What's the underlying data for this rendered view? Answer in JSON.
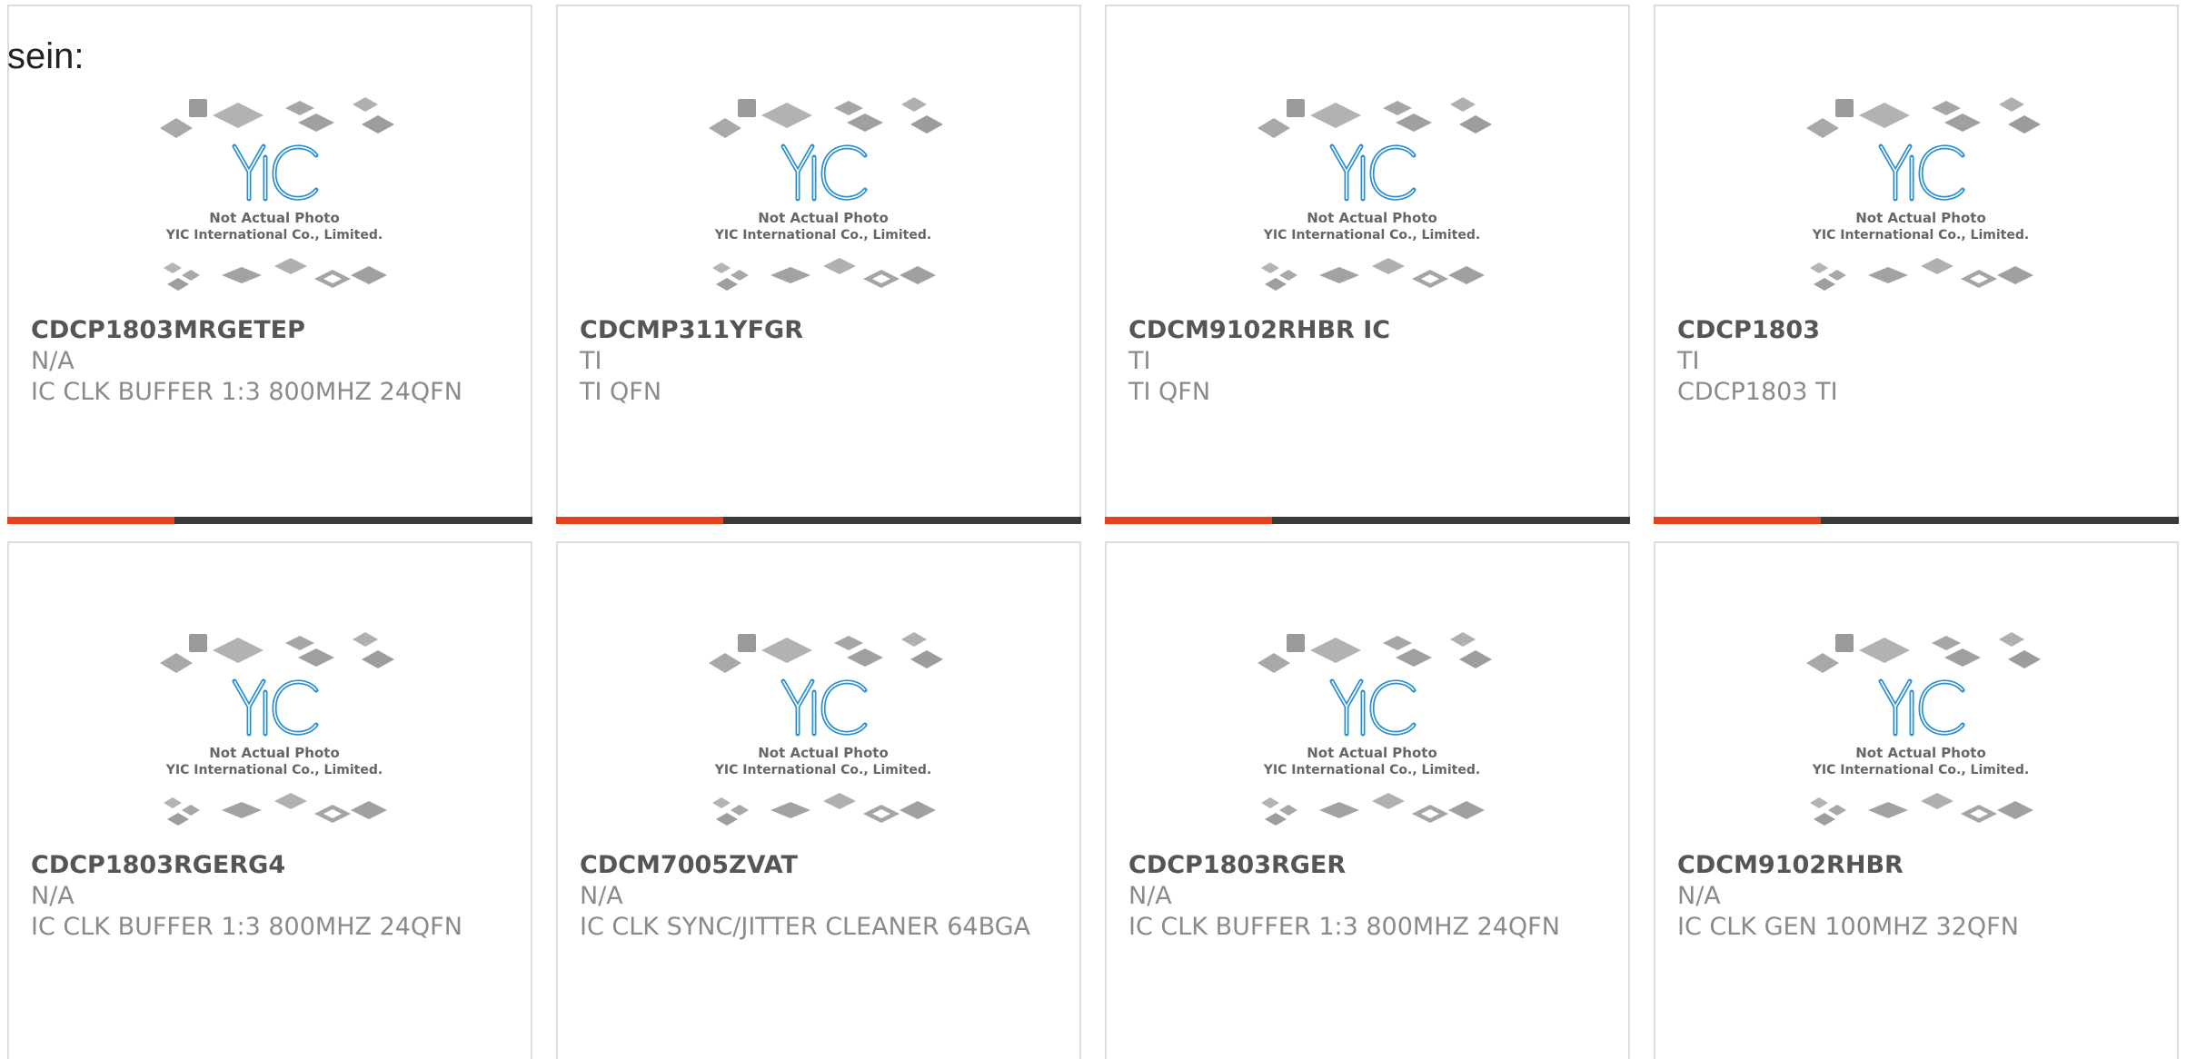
{
  "intro_text": "sein:",
  "placeholder": {
    "caption1": "Not Actual Photo",
    "caption2": "YIC International Co., Limited.",
    "logo": "YIC"
  },
  "colors": {
    "accent": "#e3421a",
    "bar": "#3a3a3a",
    "logo": "#2a8fd0"
  },
  "products": [
    {
      "part": "CDCP1803MRGETEP",
      "mfr": "N/A",
      "desc": "IC CLK BUFFER 1:3 800MHZ 24QFN"
    },
    {
      "part": "CDCMP311YFGR",
      "mfr": "TI",
      "desc": "TI QFN"
    },
    {
      "part": "CDCM9102RHBR IC",
      "mfr": "TI",
      "desc": "TI QFN"
    },
    {
      "part": "CDCP1803",
      "mfr": "TI",
      "desc": "CDCP1803 TI"
    },
    {
      "part": "CDCP1803RGERG4",
      "mfr": "N/A",
      "desc": "IC CLK BUFFER 1:3 800MHZ 24QFN"
    },
    {
      "part": "CDCM7005ZVAT",
      "mfr": "N/A",
      "desc": "IC CLK SYNC/JITTER CLEANER 64BGA"
    },
    {
      "part": "CDCP1803RGER",
      "mfr": "N/A",
      "desc": "IC CLK BUFFER 1:3 800MHZ 24QFN"
    },
    {
      "part": "CDCM9102RHBR",
      "mfr": "N/A",
      "desc": "IC CLK GEN 100MHZ 32QFN"
    }
  ]
}
